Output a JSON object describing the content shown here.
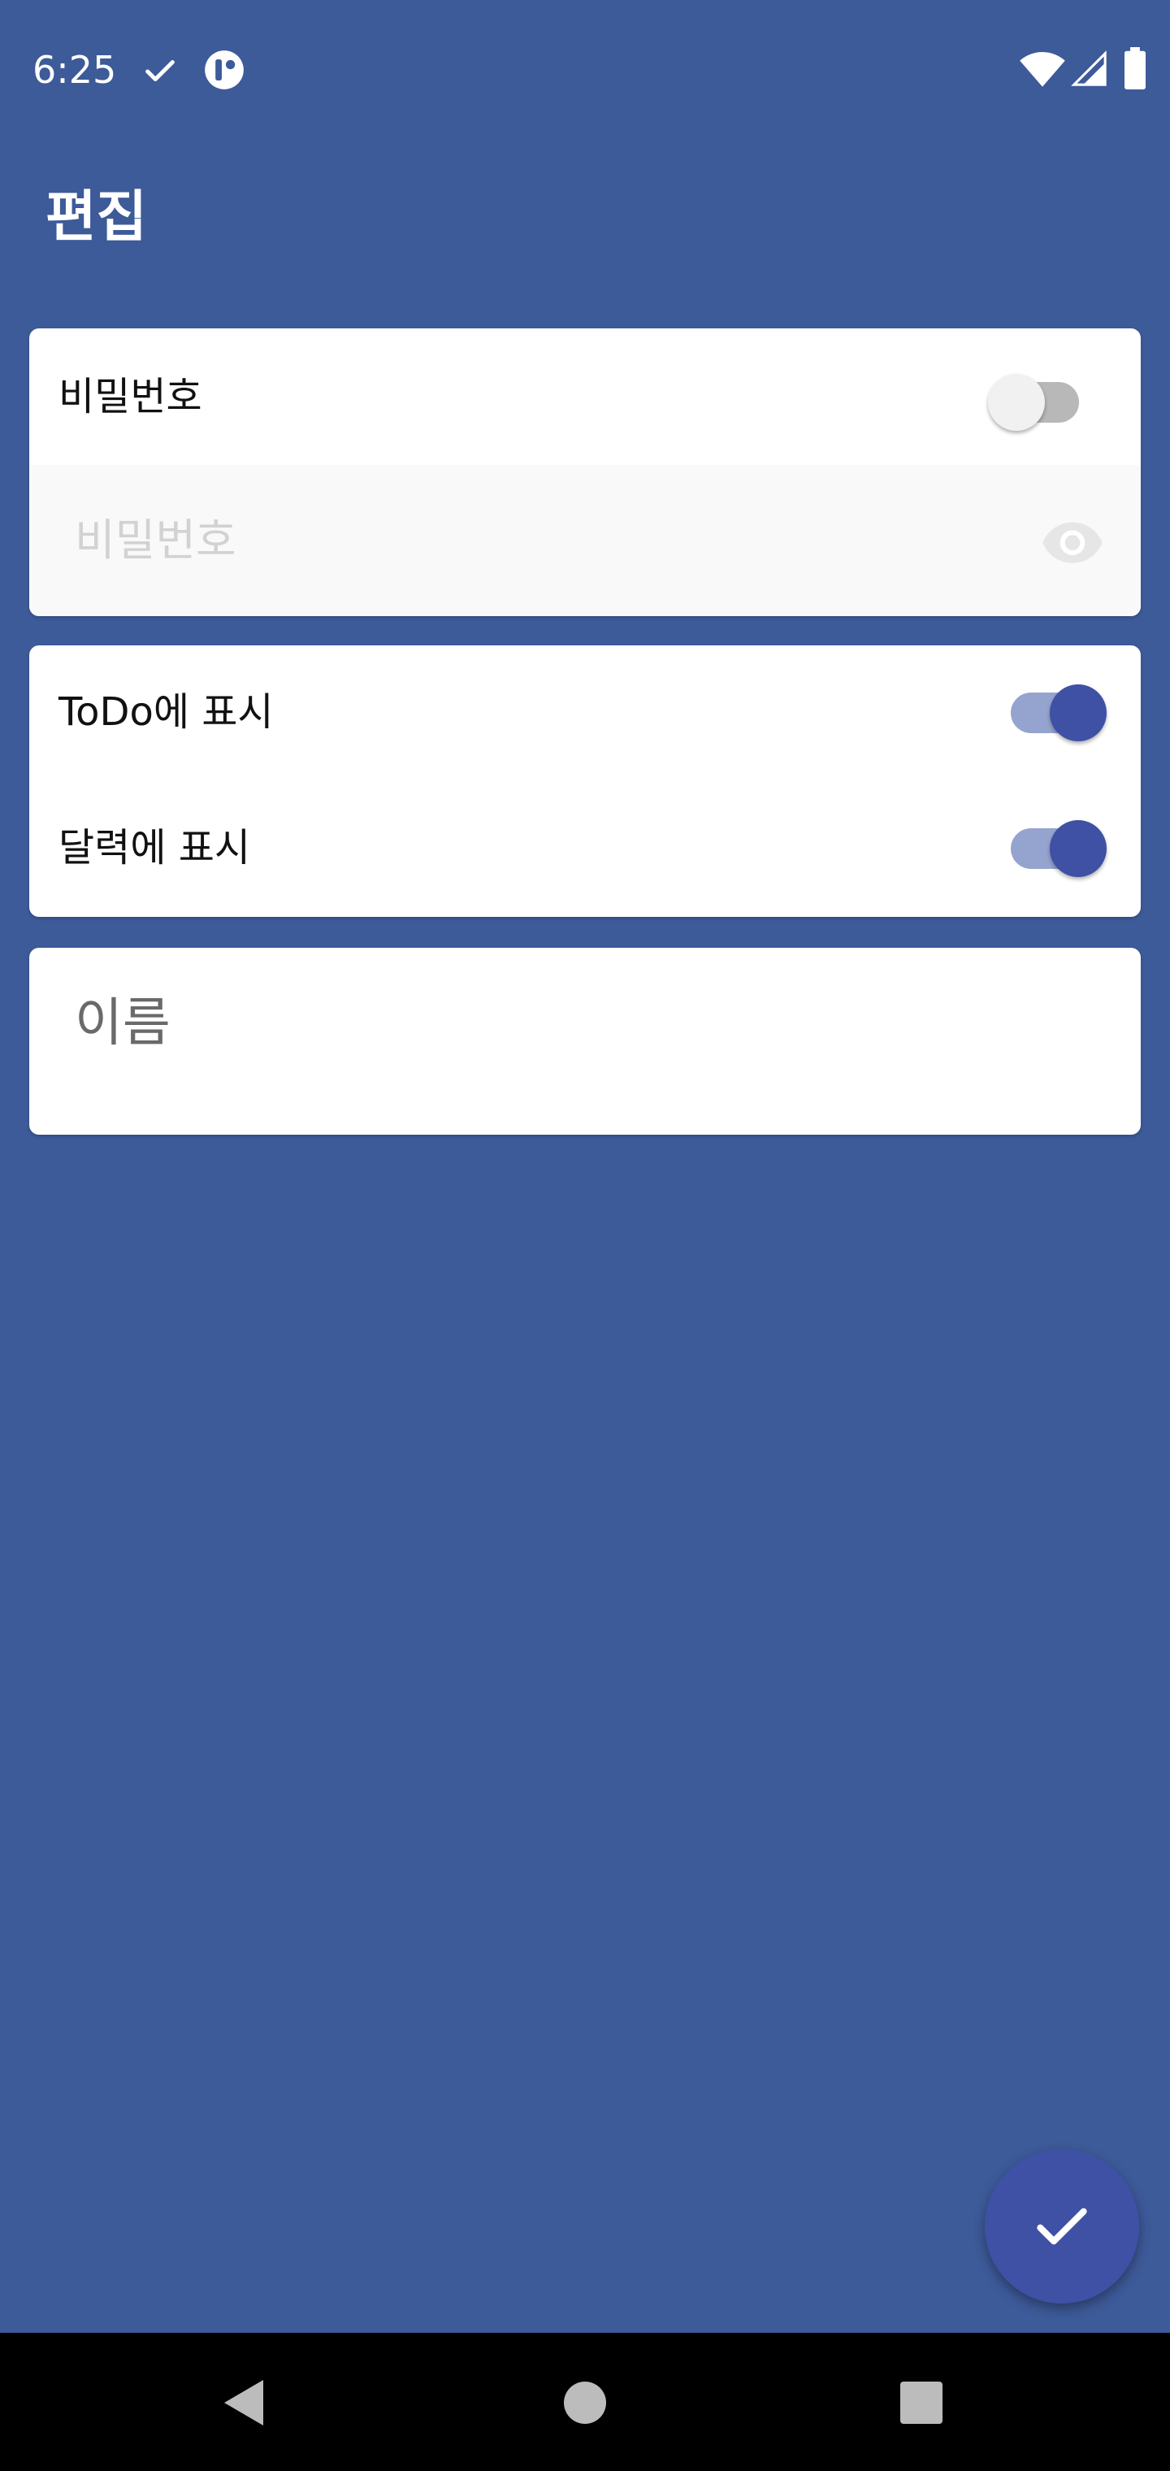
{
  "status_bar": {
    "time": "6:25",
    "icons": [
      "check-icon",
      "app-notification-icon",
      "wifi-icon",
      "signal-icon",
      "battery-icon"
    ]
  },
  "header": {
    "title": "편집"
  },
  "password_card": {
    "toggle_label": "비밀번호",
    "toggle_on": false,
    "input_placeholder": "비밀번호",
    "input_value": "",
    "visibility_icon": "eye-icon"
  },
  "display_card": {
    "todo_label": "ToDo에 표시",
    "todo_on": true,
    "calendar_label": "달력에 표시",
    "calendar_on": true
  },
  "name_card": {
    "input_placeholder": "이름",
    "input_value": ""
  },
  "fab": {
    "icon": "check-icon"
  },
  "nav_bar": {
    "icons": [
      "back-icon",
      "home-icon",
      "recents-icon"
    ]
  },
  "colors": {
    "background": "#3d5a99",
    "accent": "#3f51a5",
    "card": "#ffffff",
    "switch_on_track": "#95a3cf",
    "switch_off_track": "#b8b8b8"
  }
}
